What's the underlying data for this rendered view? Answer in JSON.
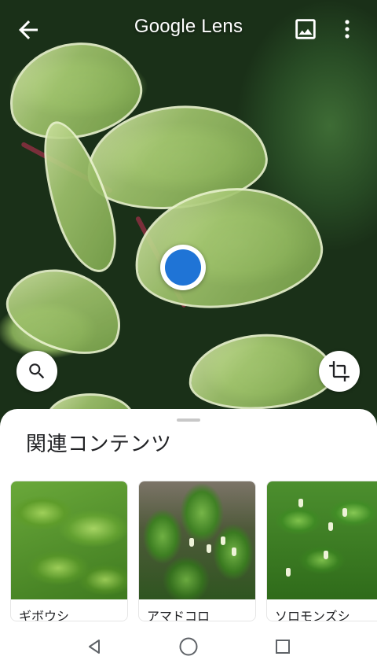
{
  "app": {
    "title": "Google Lens"
  },
  "toolbar": {
    "back_icon": "arrow-back-icon",
    "gallery_icon": "image-icon",
    "more_icon": "more-vert-icon"
  },
  "actions": {
    "search_icon": "search-icon",
    "crop_icon": "crop-icon"
  },
  "sheet": {
    "title": "関連コンテンツ",
    "results": [
      {
        "label": "ギボウシ"
      },
      {
        "label": "アマドコロ"
      },
      {
        "label": "ソロモンズシ"
      }
    ]
  },
  "navbar": {
    "back_icon": "nav-back-triangle-icon",
    "home_icon": "nav-home-circle-icon",
    "recents_icon": "nav-recents-square-icon"
  },
  "colors": {
    "accent": "#1f74d6",
    "sheet_bg": "#ffffff",
    "text_primary": "#202124"
  }
}
